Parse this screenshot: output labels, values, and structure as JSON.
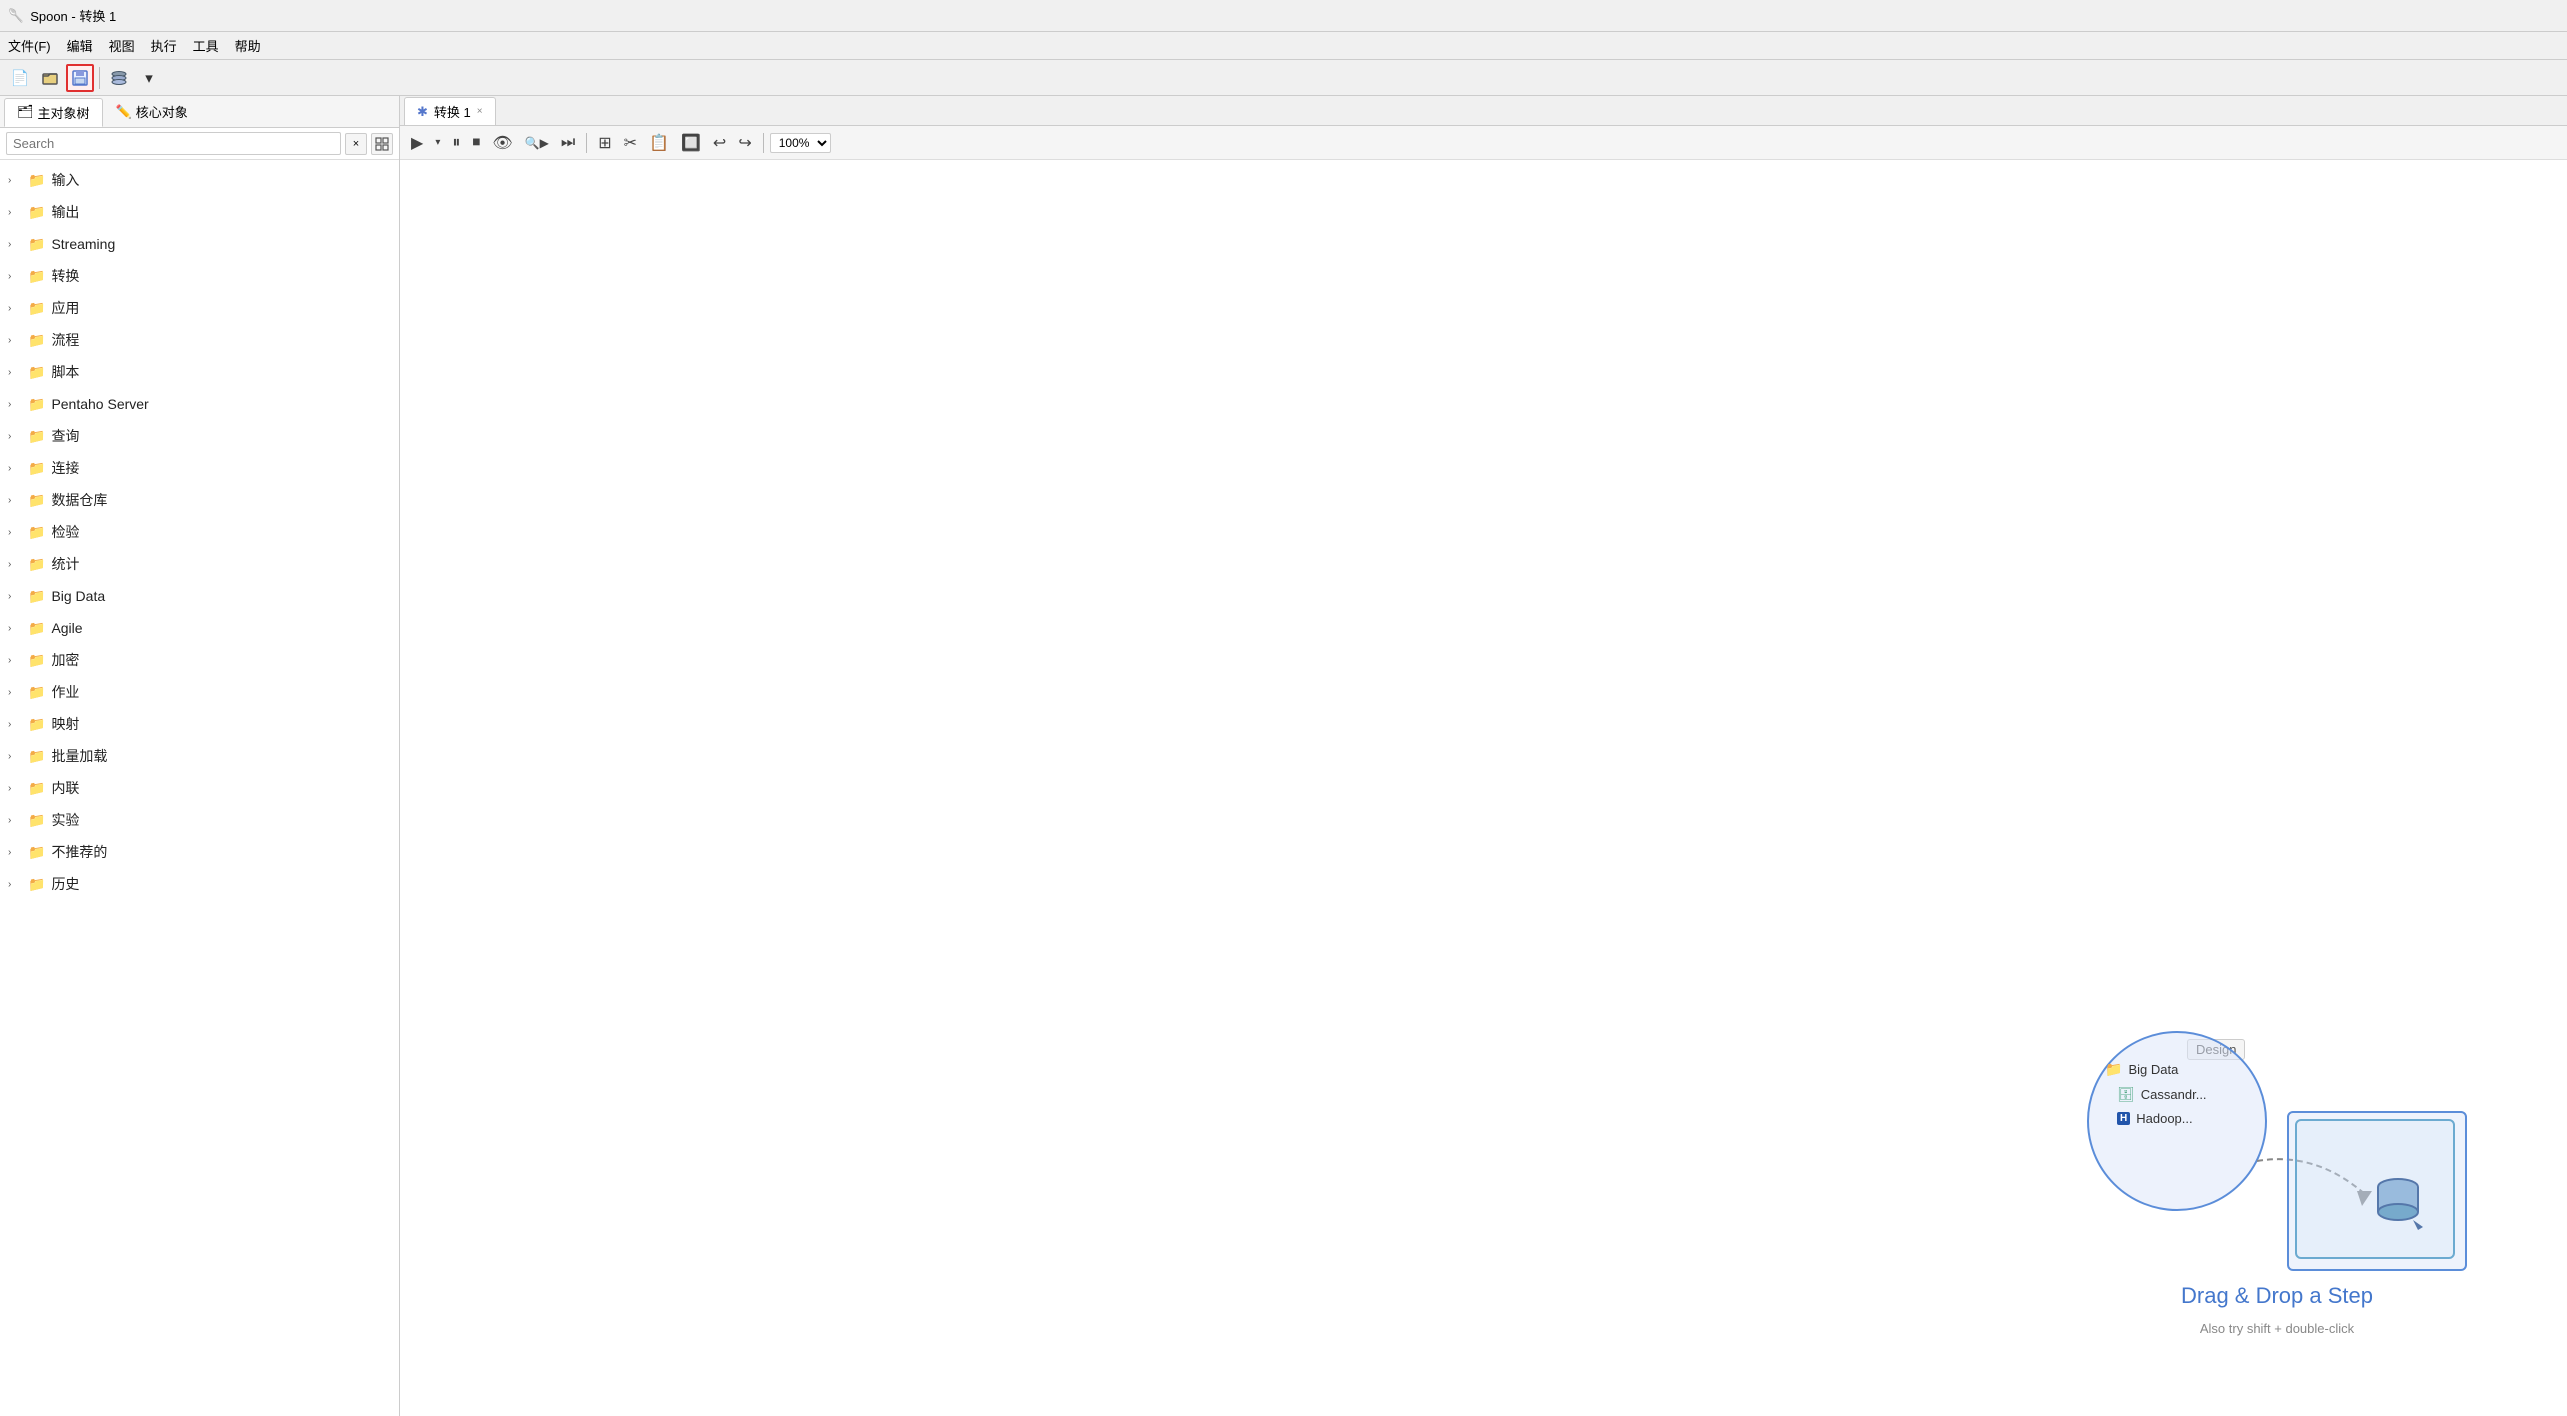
{
  "titleBar": {
    "icon": "🥄",
    "title": "Spoon - 转换 1"
  },
  "menuBar": {
    "items": [
      {
        "label": "文件(F)"
      },
      {
        "label": "编辑"
      },
      {
        "label": "视图"
      },
      {
        "label": "执行"
      },
      {
        "label": "工具"
      },
      {
        "label": "帮助"
      }
    ]
  },
  "toolbar": {
    "buttons": [
      {
        "name": "new-btn",
        "icon": "📄",
        "tooltip": "New"
      },
      {
        "name": "open-btn",
        "icon": "📂",
        "tooltip": "Open"
      },
      {
        "name": "save-btn",
        "icon": "💾",
        "tooltip": "Save",
        "highlighted": true
      },
      {
        "name": "layers-btn",
        "icon": "⚡",
        "tooltip": "Layers"
      },
      {
        "name": "dropdown-btn",
        "icon": "▾",
        "tooltip": "Dropdown"
      }
    ]
  },
  "leftPanel": {
    "tabs": [
      {
        "label": "主对象树",
        "icon": "🗂",
        "active": true
      },
      {
        "label": "核心对象",
        "icon": "✏️",
        "active": false
      }
    ],
    "search": {
      "placeholder": "Search",
      "clear_label": "×",
      "expand_label": "⊞"
    },
    "treeItems": [
      {
        "label": "输入"
      },
      {
        "label": "输出"
      },
      {
        "label": "Streaming"
      },
      {
        "label": "转换"
      },
      {
        "label": "应用"
      },
      {
        "label": "流程"
      },
      {
        "label": "脚本"
      },
      {
        "label": "Pentaho Server"
      },
      {
        "label": "查询"
      },
      {
        "label": "连接"
      },
      {
        "label": "数据仓库"
      },
      {
        "label": "检验"
      },
      {
        "label": "统计"
      },
      {
        "label": "Big Data"
      },
      {
        "label": "Agile"
      },
      {
        "label": "加密"
      },
      {
        "label": "作业"
      },
      {
        "label": "映射"
      },
      {
        "label": "批量加载"
      },
      {
        "label": "内联"
      },
      {
        "label": "实验"
      },
      {
        "label": "不推荐的"
      },
      {
        "label": "历史"
      }
    ]
  },
  "canvasPanel": {
    "tab": {
      "icon": "✱",
      "label": "转换 1",
      "close": "×"
    },
    "toolbar": {
      "play": "▶",
      "playDropdown": "▾",
      "pause": "⏸",
      "stop": "⏹",
      "preview": "👁",
      "debug": "🔍",
      "stepForward": "⏭",
      "icons": [
        "✱",
        "✂",
        "⚡",
        "⊞",
        "📋",
        "🔲"
      ],
      "zoom": "100%"
    },
    "dnd": {
      "design_label": "Design",
      "circle_folder": "Big Data",
      "circle_db": "Cassandr...",
      "circle_h": "Hadoop...",
      "title": "Drag & Drop a Step",
      "subtitle": "Also try shift + double-click"
    }
  }
}
